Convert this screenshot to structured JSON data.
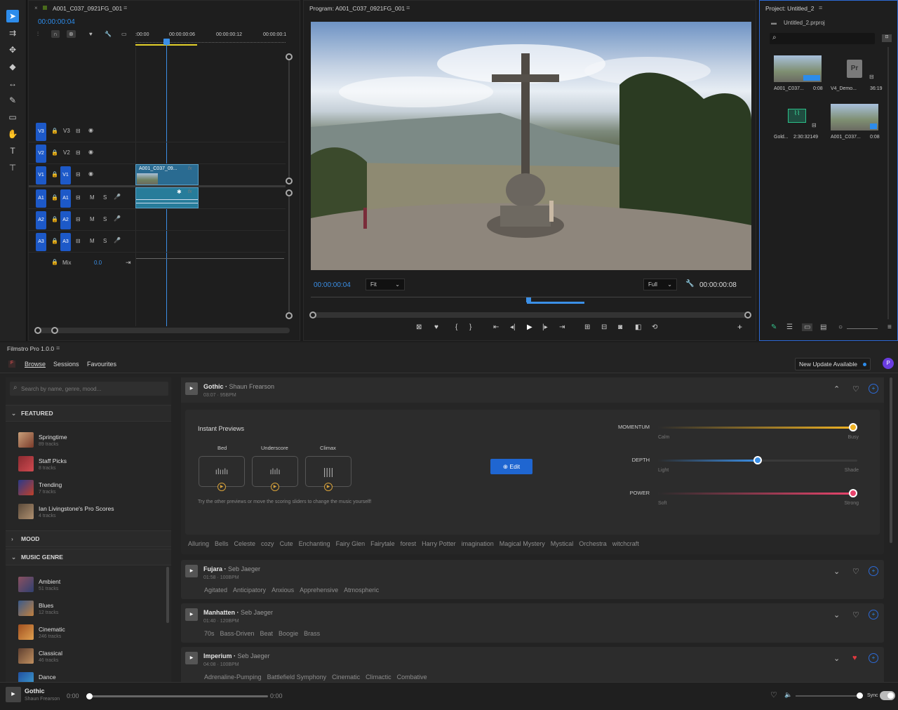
{
  "tl": {
    "title": "A001_C037_0921FG_001",
    "tc": "00:00:00:04",
    "r1": ":00:00",
    "r2": "00:00:00:06",
    "r3": "00:00:00:12",
    "r4": "00:00:00:1",
    "clip": "A001_C037_09...",
    "fx": "fx",
    "mix": "Mix",
    "mixval": "0.0",
    "tracks": [
      {
        "a": "V3",
        "b": "V3"
      },
      {
        "a": "V2",
        "b": "V2"
      },
      {
        "a": "V1",
        "b": "V1"
      },
      {
        "a": "A1",
        "b": "A1"
      },
      {
        "a": "A2",
        "b": "A2"
      },
      {
        "a": "A3",
        "b": "A3"
      }
    ],
    "m": "M",
    "s": "S"
  },
  "prog": {
    "title": "Program: A001_C037_0921FG_001",
    "tc_left": "00:00:00:04",
    "fit": "Fit",
    "full": "Full",
    "tc_right": "00:00:00:08"
  },
  "proj": {
    "title": "Project: Untitled_2",
    "file": "Untitled_2.prproj",
    "items": [
      {
        "name": "A001_C037...",
        "dur": "0:08"
      },
      {
        "name": "V4_Demo...",
        "dur": "36:19"
      },
      {
        "name": "Gold...",
        "dur": "2:30:32149"
      },
      {
        "name": "A001_C037...",
        "dur": "0:08"
      }
    ]
  },
  "fs": {
    "title": "Filmstro Pro 1.0.0",
    "tabs": [
      "Browse",
      "Sessions",
      "Favourites"
    ],
    "update": "New Update Available",
    "avatar": "P",
    "search": "Search by name, genre, mood...",
    "featured": "FEATURED",
    "mood": "MOOD",
    "genre": "MUSIC GENRE",
    "feat": [
      {
        "n": "Springtime",
        "s": "89 tracks"
      },
      {
        "n": "Staff Picks",
        "s": "8 tracks"
      },
      {
        "n": "Trending",
        "s": "7 tracks"
      },
      {
        "n": "Ian Livingstone's Pro Scores",
        "s": "4 tracks"
      }
    ],
    "genres": [
      {
        "n": "Ambient",
        "s": "51 tracks"
      },
      {
        "n": "Blues",
        "s": "12 tracks"
      },
      {
        "n": "Cinematic",
        "s": "246 tracks"
      },
      {
        "n": "Classical",
        "s": "46 tracks"
      },
      {
        "n": "Dance",
        "s": ""
      }
    ],
    "tracks": [
      {
        "t": "Gothic",
        "a": "Shaun Frearson",
        "m": "03:07 · 95BPM",
        "tags": [
          "Alluring",
          "Bells",
          "Celeste",
          "cozy",
          "Cute",
          "Enchanting",
          "Fairy Glen",
          "Fairytale",
          "forest",
          "Harry Potter",
          "imagination",
          "Magical Mystery",
          "Mystical",
          "Orchestra",
          "witchcraft"
        ]
      },
      {
        "t": "Fujara",
        "a": "Seb Jaeger",
        "m": "01:58 · 100BPM",
        "tags": [
          "Agitated",
          "Anticipatory",
          "Anxious",
          "Apprehensive",
          "Atmospheric"
        ]
      },
      {
        "t": "Manhatten",
        "a": "Seb Jaeger",
        "m": "01:40 · 120BPM",
        "tags": [
          "70s",
          "Bass-Driven",
          "Beat",
          "Boogie",
          "Brass"
        ]
      },
      {
        "t": "Imperium",
        "a": "Seb Jaeger",
        "m": "04:08 · 100BPM",
        "tags": [
          "Adrenaline-Pumping",
          "Battlefield Symphony",
          "Cinematic",
          "Climactic",
          "Combative"
        ]
      }
    ],
    "instant": "Instant Previews",
    "prev": [
      "Bed",
      "Underscore",
      "Climax"
    ],
    "hint": "Try the other previews or move the scoring sliders to change the music yourself!",
    "edit": "Edit",
    "sliders": [
      {
        "n": "MOMENTUM",
        "l": "Calm",
        "r": "Busy",
        "v": 0.98,
        "c": "#f0b324"
      },
      {
        "n": "DEPTH",
        "l": "Light",
        "r": "Shade",
        "v": 0.5,
        "c": "#3b8fe6"
      },
      {
        "n": "POWER",
        "l": "Soft",
        "r": "Strong",
        "v": 0.98,
        "c": "#e8446c"
      }
    ],
    "player": {
      "t": "Gothic",
      "a": "Shaun Frearson",
      "start": "0:00",
      "end": "0:00",
      "sync": "Sync"
    }
  }
}
